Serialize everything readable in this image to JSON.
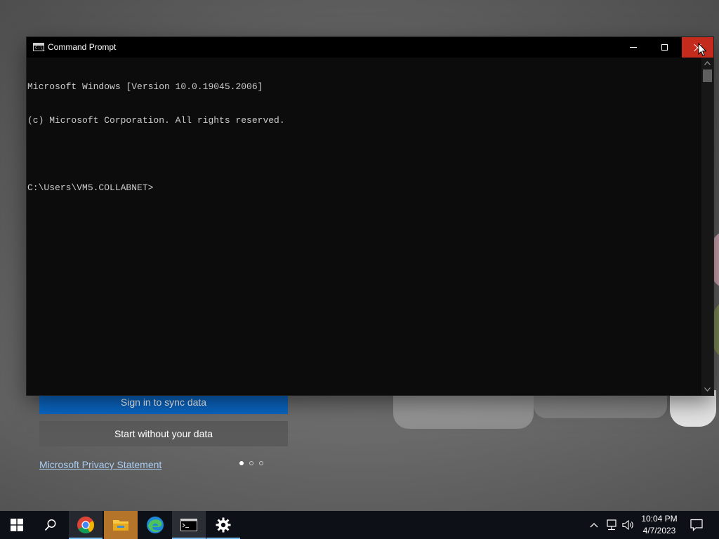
{
  "background_app": {
    "sign_in_button": "Sign in to sync data",
    "start_without_button": "Start without your data",
    "privacy_link": "Microsoft Privacy Statement",
    "carousel_dots": 3,
    "carousel_active_index": 0
  },
  "cmd_window": {
    "title": "Command Prompt",
    "icon_text": "C:\\_",
    "lines": [
      "Microsoft Windows [Version 10.0.19045.2006]",
      "(c) Microsoft Corporation. All rights reserved.",
      "",
      "C:\\Users\\VM5.COLLABNET>"
    ],
    "close_hover_color": "#c42b1c"
  },
  "taskbar": {
    "items": [
      "start-icon",
      "search-icon",
      "chrome-icon",
      "file-explorer-icon",
      "edge-icon",
      "command-prompt-icon",
      "settings-icon"
    ],
    "clock": {
      "time": "10:04 PM",
      "date": "4/7/2023"
    },
    "accent_color": "#76b9ed"
  }
}
